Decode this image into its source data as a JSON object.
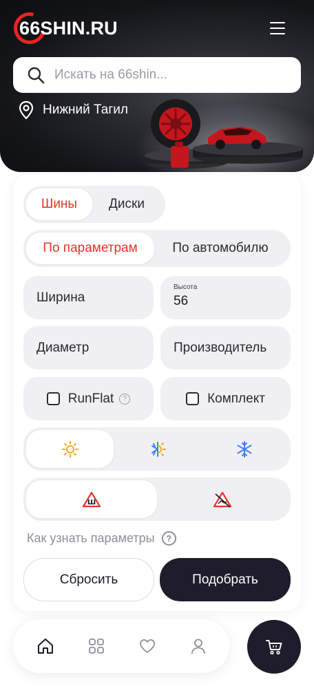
{
  "header": {
    "logo_text": "66SHIN.RU",
    "menu_icon": "hamburger-icon"
  },
  "search": {
    "placeholder": "Искать на 66shin...",
    "icon": "search-icon"
  },
  "location": {
    "city": "Нижний Тагил",
    "icon": "location-pin-icon"
  },
  "colors": {
    "accent": "#e5332a",
    "dark": "#1f1d2b",
    "field_bg": "#f0f0f3",
    "summer_icon": "#f5a623",
    "winter_icon": "#3b82f6"
  },
  "category_tabs": [
    {
      "label": "Шины",
      "active": true
    },
    {
      "label": "Диски",
      "active": false
    }
  ],
  "mode_tabs": [
    {
      "label": "По параметрам",
      "active": true
    },
    {
      "label": "По автомобилю",
      "active": false
    }
  ],
  "fields": {
    "width": {
      "label": "Ширина"
    },
    "height": {
      "label": "Высота",
      "value": "56"
    },
    "diameter": {
      "label": "Диаметр"
    },
    "manufacturer": {
      "label": "Производитель"
    }
  },
  "checkboxes": {
    "runflat": {
      "label": "RunFlat",
      "checked": false,
      "help": "?"
    },
    "kit": {
      "label": "Комплект",
      "checked": false
    }
  },
  "season_options": [
    {
      "icon": "sun-icon",
      "active": true
    },
    {
      "icon": "all-season-icon",
      "active": false
    },
    {
      "icon": "snowflake-icon",
      "active": false
    }
  ],
  "stud_options": [
    {
      "icon": "studded-sign-icon",
      "symbol": "Ш",
      "active": true
    },
    {
      "icon": "non-studded-sign-icon",
      "active": false
    }
  ],
  "help_link": {
    "label": "Как узнать параметры",
    "icon_text": "?"
  },
  "actions": {
    "reset": "Сбросить",
    "pick": "Подобрать"
  },
  "bottom_nav": [
    {
      "icon": "home-icon",
      "active": true
    },
    {
      "icon": "catalog-grid-icon",
      "active": false
    },
    {
      "icon": "heart-icon",
      "active": false
    },
    {
      "icon": "user-icon",
      "active": false
    }
  ],
  "cart": {
    "icon": "cart-icon"
  }
}
